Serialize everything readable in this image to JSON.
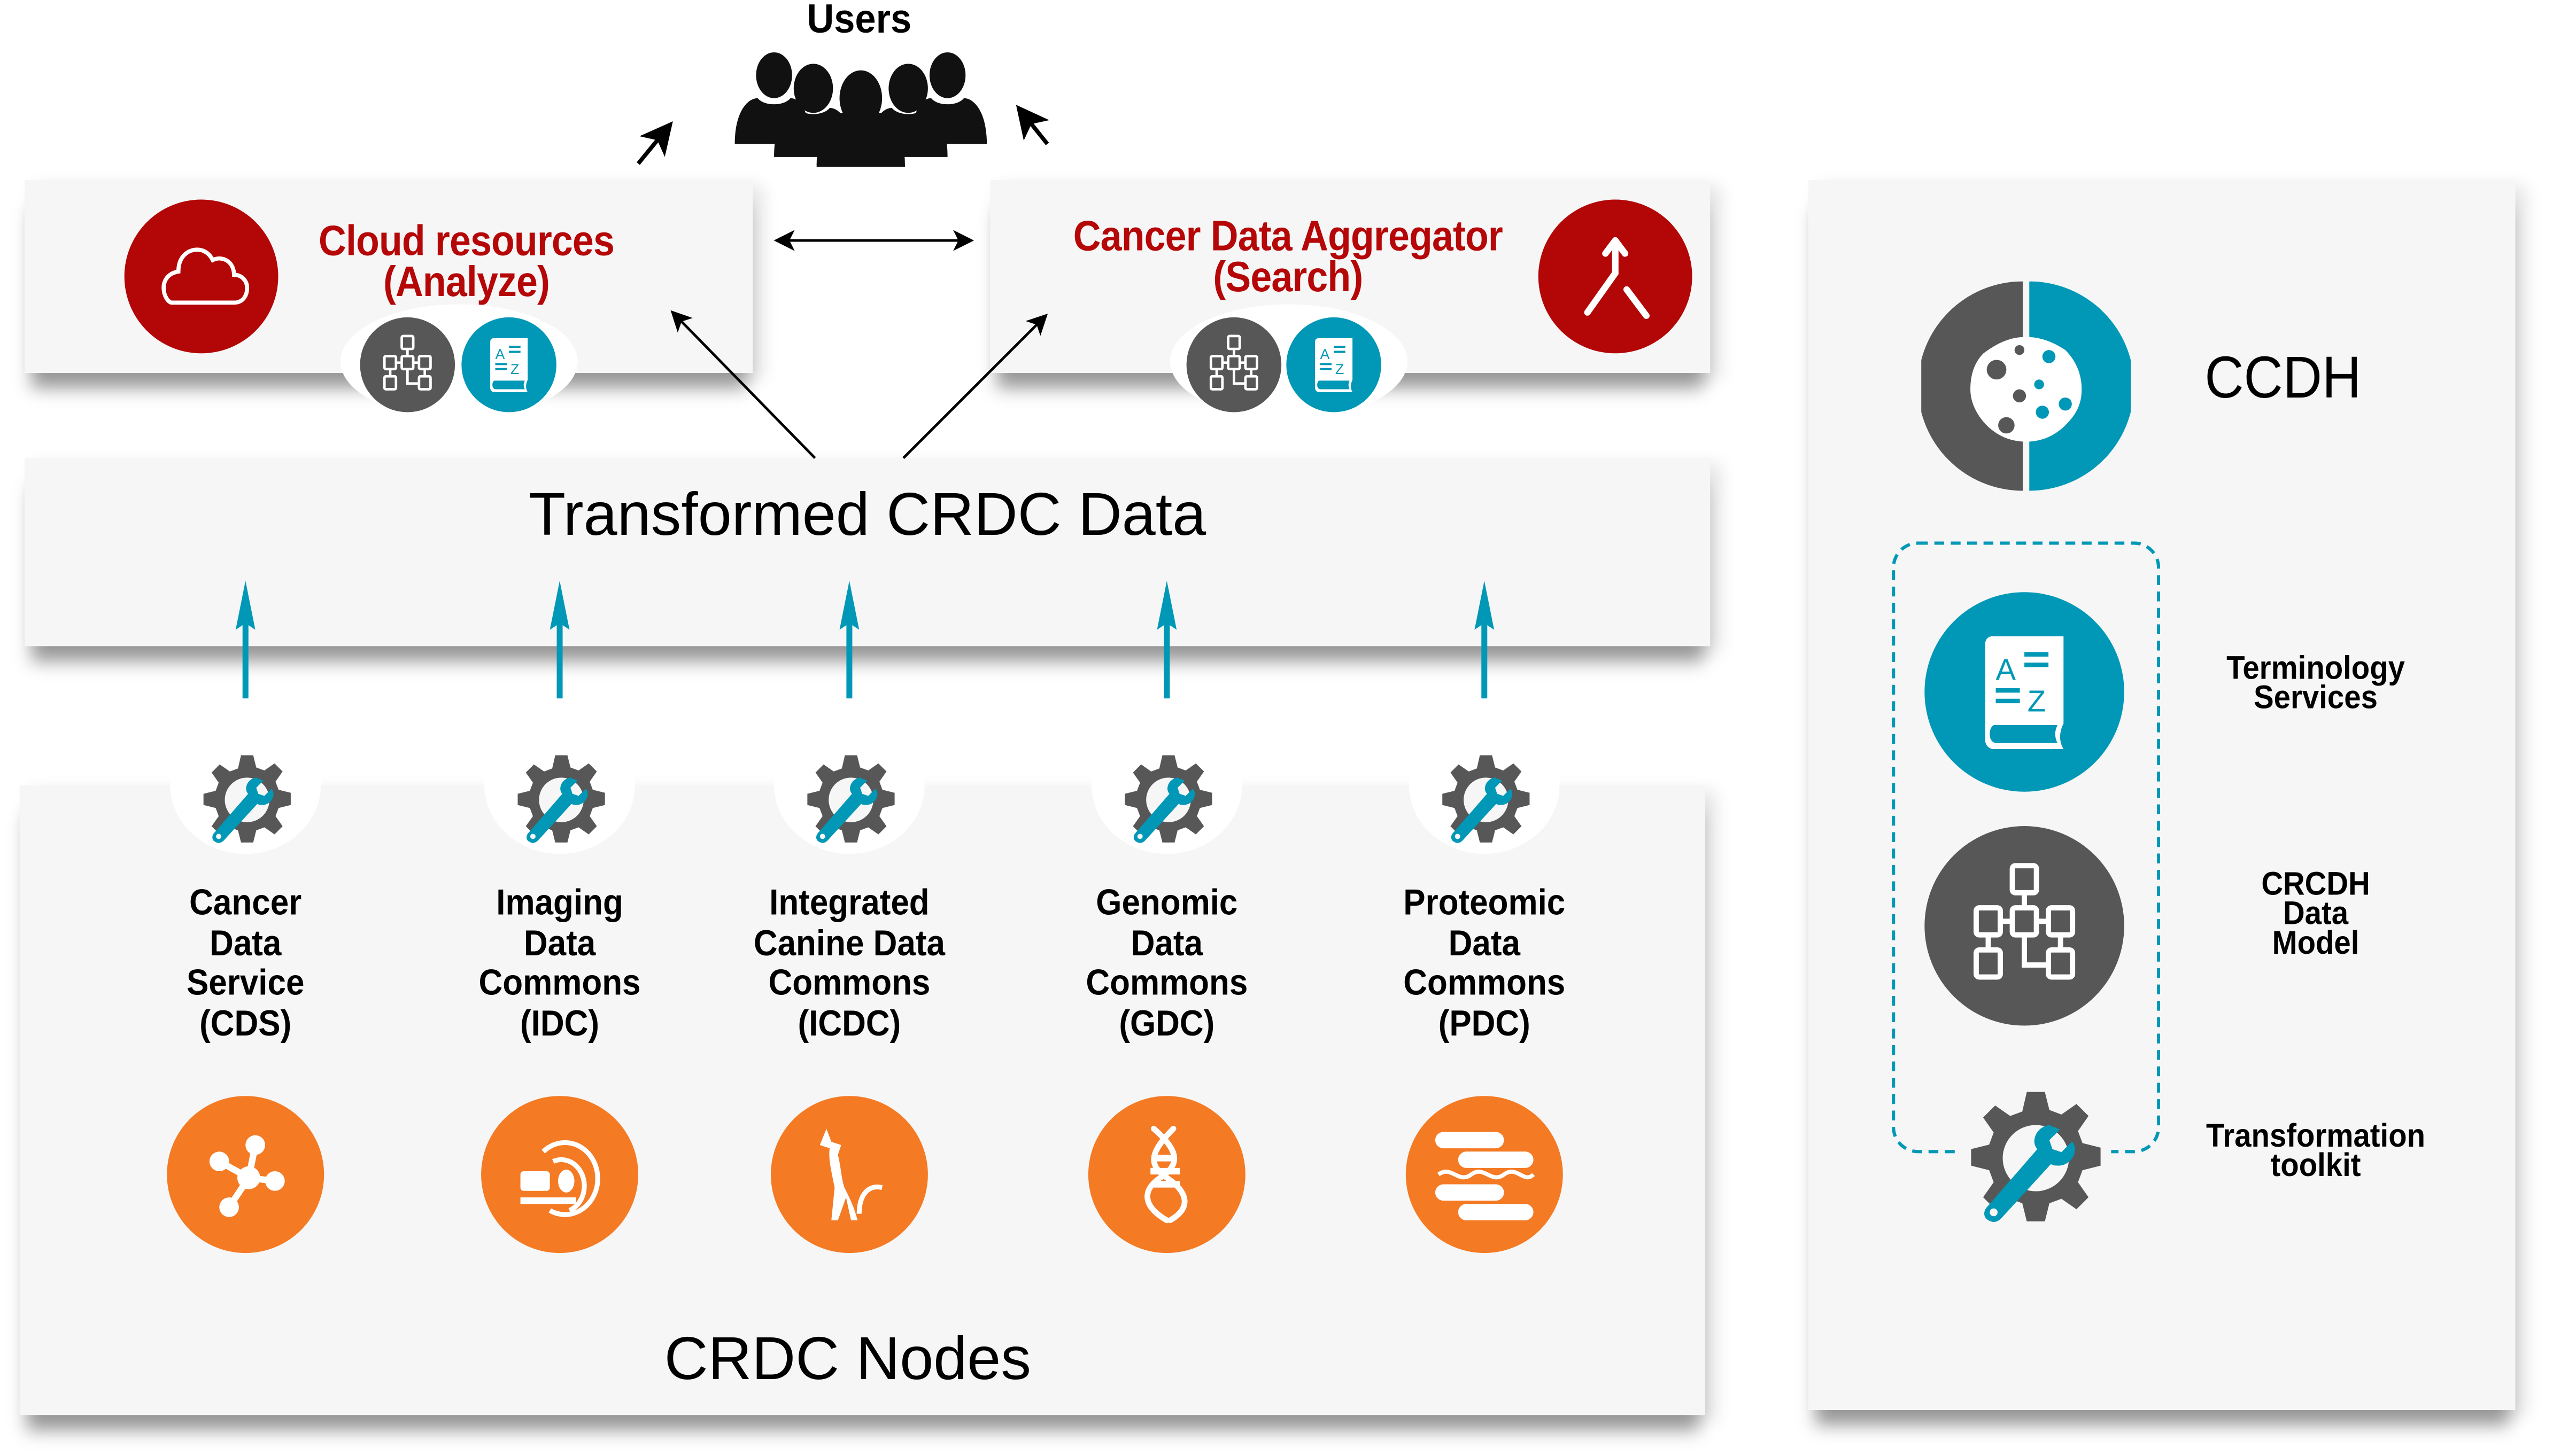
{
  "users": {
    "label": "Users",
    "icon": "users-group-icon"
  },
  "analysis_layer": {
    "cloud_resources": {
      "title_line1": "Cloud resources",
      "title_line2": "(Analyze)",
      "icon": "cloud-icon",
      "sub_icons": [
        "data-model-icon",
        "terminology-book-icon"
      ]
    },
    "cancer_data_aggregator": {
      "title_line1": "Cancer Data Aggregator",
      "title_line2": "(Search)",
      "icon": "merge-arrow-icon",
      "sub_icons": [
        "data-model-icon",
        "terminology-book-icon"
      ]
    }
  },
  "transformed_data": {
    "label": "Transformed CRDC Data"
  },
  "crdc_nodes": {
    "label": "CRDC Nodes",
    "nodes": [
      {
        "lines": [
          "Cancer",
          "Data",
          "Service",
          "(CDS)"
        ],
        "icon": "network-molecule-icon",
        "tool_icon": "gear-wrench-icon"
      },
      {
        "lines": [
          "Imaging",
          "Data",
          "Commons",
          "(IDC)"
        ],
        "icon": "mri-scanner-icon",
        "tool_icon": "gear-wrench-icon"
      },
      {
        "lines": [
          "Integrated",
          "Canine Data",
          "Commons",
          "(ICDC)"
        ],
        "icon": "dog-icon",
        "tool_icon": "gear-wrench-icon"
      },
      {
        "lines": [
          "Genomic",
          "Data",
          "Commons",
          "(GDC)"
        ],
        "icon": "dna-icon",
        "tool_icon": "gear-wrench-icon"
      },
      {
        "lines": [
          "Proteomic",
          "Data",
          "Commons",
          "(PDC)"
        ],
        "icon": "protein-cylinders-icon",
        "tool_icon": "gear-wrench-icon"
      }
    ]
  },
  "legend": {
    "title": "CCDH",
    "logo_icon": "ccdh-cell-icon",
    "items": [
      {
        "lines": [
          "Terminology",
          "Services"
        ],
        "icon": "terminology-book-icon"
      },
      {
        "lines": [
          "CRCDH",
          "Data",
          "Model"
        ],
        "icon": "data-model-icon"
      },
      {
        "lines": [
          "Transformation",
          "toolkit"
        ],
        "icon": "gear-wrench-icon"
      }
    ]
  },
  "colors": {
    "red": "#b30606",
    "teal": "#0098b6",
    "grey": "#575757",
    "orange": "#f47a24",
    "panel": "#f6f6f6"
  }
}
